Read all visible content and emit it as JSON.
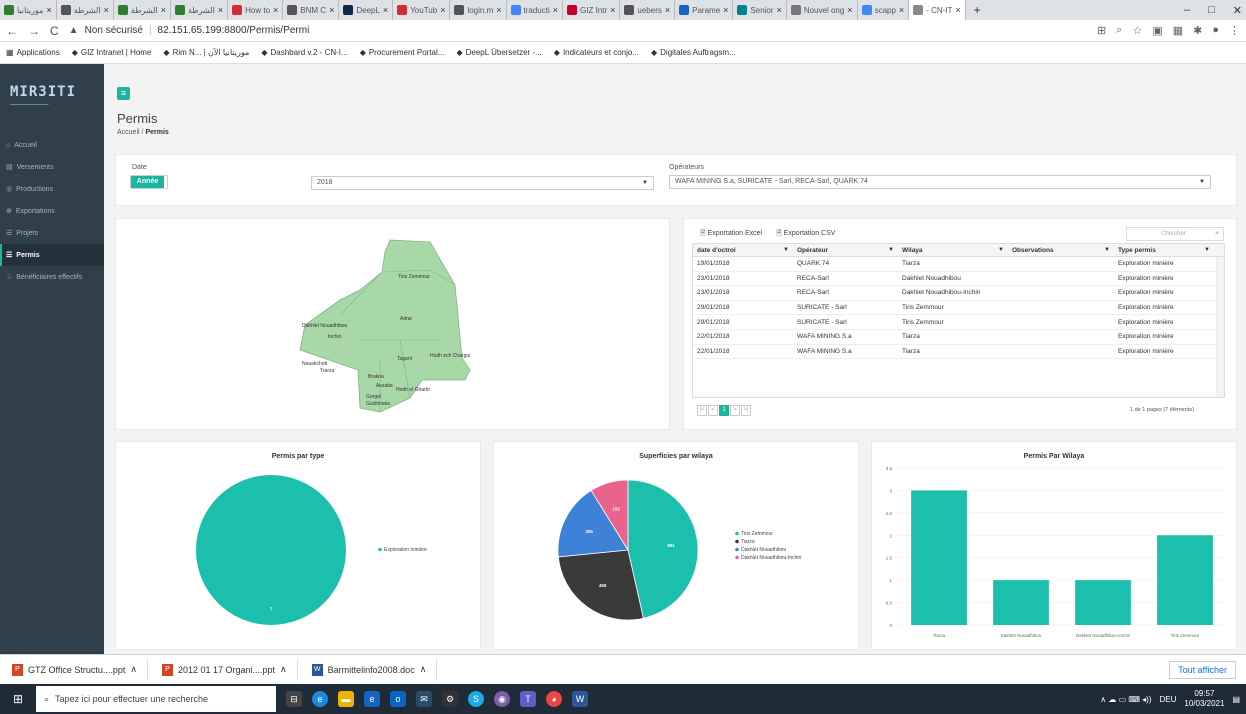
{
  "browser": {
    "tabs": [
      {
        "label": "موريتانيا"
      },
      {
        "label": "الشرطة"
      },
      {
        "label": "الشرطة"
      },
      {
        "label": "الشرطة"
      },
      {
        "label": "How to"
      },
      {
        "label": "BNM C"
      },
      {
        "label": "DeepL"
      },
      {
        "label": "YouTub"
      },
      {
        "label": "login.m"
      },
      {
        "label": "traducti"
      },
      {
        "label": "GIZ Intr"
      },
      {
        "label": "uebers"
      },
      {
        "label": "Parame"
      },
      {
        "label": "Senior"
      },
      {
        "label": "Nouvel ong"
      },
      {
        "label": "scapp"
      },
      {
        "label": "- CN-IT"
      }
    ],
    "new_tab": "+",
    "url_warning": "Non sécurisé",
    "url": "82.151.65.199:8800/Permis/Permi",
    "bookmarks": [
      "Applications",
      "GIZ Intranet | Home",
      "Rim N... | موريتانيا الآن",
      "Dashbard v.2 - CN-I...",
      "Procurement Portal...",
      "DeepL Übersetzer -...",
      "Indicateurs et conjo...",
      "Digitales Auftragsm..."
    ]
  },
  "sidebar": {
    "logo": "MIR3ITI",
    "items": [
      {
        "icon": "home-icon",
        "glyph": "⌂",
        "label": "Accueil"
      },
      {
        "icon": "document-icon",
        "glyph": "▤",
        "label": "Versements"
      },
      {
        "icon": "production-icon",
        "glyph": "◎",
        "label": "Productions"
      },
      {
        "icon": "export-icon",
        "glyph": "⊕",
        "label": "Exportations"
      },
      {
        "icon": "list-icon",
        "glyph": "☰",
        "label": "Projets"
      },
      {
        "icon": "list-icon",
        "glyph": "☰",
        "label": "Permis"
      },
      {
        "icon": "people-icon",
        "glyph": "♧",
        "label": "Bénéficiaires effectifs"
      }
    ],
    "active_index": 5
  },
  "header": {
    "title": "Permis",
    "breadcrumb_home": "Accueil",
    "breadcrumb_sep": "/",
    "breadcrumb_current": "Permis"
  },
  "filters": {
    "date_label": "Date",
    "toggle_label": "Année",
    "year_value": "2018",
    "operator_label": "Opérateurs",
    "operator_value": "WAFA MINING S.a, SURICATE - Sarl, RECA-Sarl, QUARK 74"
  },
  "map": {
    "regions": [
      "Tiris Zemmour",
      "Adrar",
      "Dakhlet Nouadhibou",
      "Inchiri",
      "Tagant",
      "Hodh ech Chargui",
      "Nouakchott",
      "Trarza",
      "Brakna",
      "Assaba",
      "Hodh el Gharbi",
      "Gorgol",
      "Guidimaka"
    ],
    "fill": "#a8d8a8"
  },
  "table": {
    "export_excel": "Exportation Excel",
    "export_csv": "Exportation CSV",
    "search_placeholder": "Chercher",
    "columns": [
      "date d'octroi",
      "Opérateur",
      "Wilaya",
      "Observations",
      "Type permis"
    ],
    "rows": [
      [
        "19/01/2018",
        "QUARK 74",
        "Tiarza",
        "",
        "Exploration minière"
      ],
      [
        "23/01/2018",
        "RECA-Sarl",
        "Dakhlet Nouadhibou",
        "",
        "Exploration minière"
      ],
      [
        "23/01/2018",
        "RECA-Sarl",
        "Dakhlet Nouadhibou-Inchiri",
        "",
        "Exploration minière"
      ],
      [
        "29/01/2018",
        "SURICATE - Sarl",
        "Tiris Zemmour",
        "",
        "Exploration minière"
      ],
      [
        "29/01/2018",
        "SURICATE - Sarl",
        "Tiris Zemmour",
        "",
        "Exploration minière"
      ],
      [
        "22/01/2018",
        "WAFA MINING S.a",
        "Tiarza",
        "",
        "Exploration minière"
      ],
      [
        "22/01/2018",
        "WAFA MINING S.a",
        "Tiarza",
        "",
        "Exploration minière"
      ]
    ],
    "pager": [
      "|<",
      "<",
      "1",
      ">",
      ">|"
    ],
    "page_info": "1 de 1 pages (7 éléments)"
  },
  "chart_data": [
    {
      "type": "pie",
      "title": "Permis par type",
      "categories": [
        "Exploration minière"
      ],
      "values": [
        7
      ],
      "colors": [
        "#1cbfab"
      ]
    },
    {
      "type": "pie",
      "title": "Superficies par wilaya",
      "categories": [
        "Tiris Zemmour",
        "Tiarza",
        "Dakhlet Nouadhibou",
        "Dakhlet Nouadhibou-Inchiri"
      ],
      "values": [
        801,
        465,
        306,
        152
      ],
      "colors": [
        "#1cbfab",
        "#3a3a3a",
        "#3d82d6",
        "#e8648c"
      ]
    },
    {
      "type": "bar",
      "title": "Permis Par Wilaya",
      "categories": [
        "Tiarza",
        "Dakhlet Nouadhibou",
        "Dakhlet Nouadhibou-Inchiri",
        "Tiris Zemmour"
      ],
      "values": [
        3,
        1,
        1,
        2
      ],
      "ylim": [
        0,
        3.5
      ],
      "yticks": [
        "0",
        "0.5",
        "1",
        "1.5",
        "2",
        "2.5",
        "3",
        "3.5"
      ],
      "color": "#1cbfab",
      "grid": true
    }
  ],
  "downloads": {
    "files": [
      {
        "name": "GTZ Office Structu....ppt",
        "kind": "ppt"
      },
      {
        "name": "2012 01 17 Organi....ppt",
        "kind": "ppt"
      },
      {
        "name": "Barmittelinfo2008.doc",
        "kind": "doc"
      }
    ],
    "show_all": "Tout afficher"
  },
  "taskbar": {
    "search_placeholder": "Tapez ici pour effectuer une recherche",
    "lang": "DEU",
    "time": "09:57",
    "date": "10/03/2021"
  }
}
